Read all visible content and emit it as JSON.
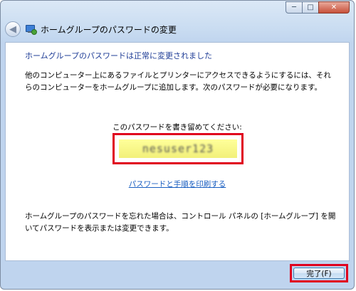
{
  "window": {
    "title": "ホームグループのパスワードの変更",
    "caption": {
      "minimize": "─",
      "maximize": "□",
      "close": "✕"
    }
  },
  "nav": {
    "back_glyph": "◀"
  },
  "content": {
    "headline": "ホームグループのパスワードは正常に変更されました",
    "description": "他のコンピューター上にあるファイルとプリンターにアクセスできるようにするには、それらのコンピューターをホームグループに追加します。次のパスワードが必要になります。",
    "prompt": "このパスワードを書き留めてください:",
    "password": "nesuser123",
    "print_link": "パスワードと手順を印刷する",
    "note": "ホームグループのパスワードを忘れた場合は、コントロール パネルの [ホームグループ] を開いてパスワードを表示または変更できます。"
  },
  "footer": {
    "finish_label": "完了(F)"
  },
  "colors": {
    "accent_red": "#e0001e",
    "headline_blue": "#1e3c96",
    "link_blue": "#1a5fc1",
    "password_bg": "#ffff9a"
  }
}
